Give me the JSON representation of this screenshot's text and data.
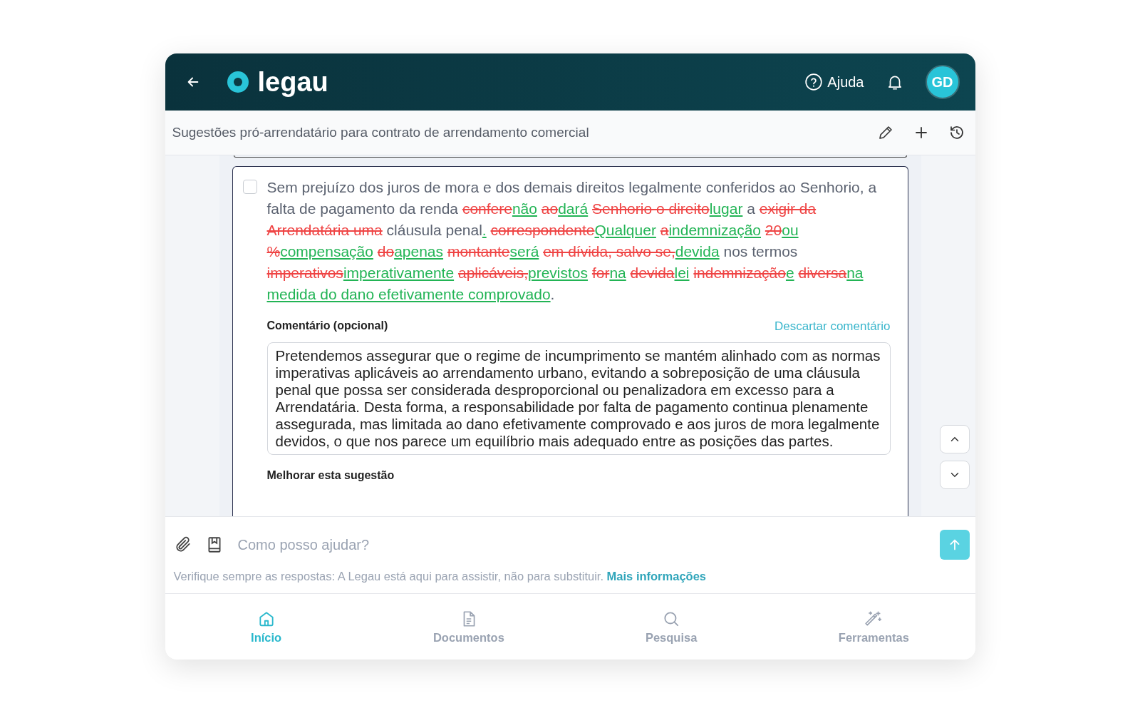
{
  "header": {
    "logo": "legau",
    "help": "Ajuda",
    "avatar": "GD"
  },
  "conversation": {
    "title": "Sugestões pró-arrendatário para contrato de arrendamento comercial"
  },
  "suggestion": {
    "checked": false,
    "segments": [
      {
        "kind": "plain",
        "text": "Sem prejuízo dos juros de mora e dos demais direitos legalmente conferidos ao Senhorio, a falta de pagamento da renda"
      },
      {
        "kind": "del",
        "text": "confere",
        "space_before": true
      },
      {
        "kind": "ins",
        "text": "não"
      },
      {
        "kind": "del",
        "text": "ao",
        "space_before": true
      },
      {
        "kind": "ins",
        "text": "dará"
      },
      {
        "kind": "del",
        "text": "Senhorio o direito",
        "space_before": true
      },
      {
        "kind": "ins",
        "text": "lugar"
      },
      {
        "kind": "plain",
        "text": "a",
        "space_before": true
      },
      {
        "kind": "del",
        "text": "exigir da Arrendatária uma",
        "space_before": true
      },
      {
        "kind": "plain",
        "text": "cláusula penal",
        "space_before": true
      },
      {
        "kind": "ins",
        "text": "."
      },
      {
        "kind": "del",
        "text": "correspondente",
        "space_before": true
      },
      {
        "kind": "ins",
        "text": "Qualquer"
      },
      {
        "kind": "del",
        "text": "a",
        "space_before": true
      },
      {
        "kind": "ins",
        "text": "indemnização"
      },
      {
        "kind": "del",
        "text": "20",
        "space_before": true
      },
      {
        "kind": "ins",
        "text": "ou"
      },
      {
        "kind": "del",
        "text": "%",
        "space_before": true
      },
      {
        "kind": "ins",
        "text": "compensação"
      },
      {
        "kind": "del",
        "text": "do",
        "space_before": true
      },
      {
        "kind": "ins",
        "text": "apenas"
      },
      {
        "kind": "del",
        "text": "montante",
        "space_before": true
      },
      {
        "kind": "ins",
        "text": "será"
      },
      {
        "kind": "del",
        "text": "em dívida, salvo se,",
        "space_before": true
      },
      {
        "kind": "ins",
        "text": "devida"
      },
      {
        "kind": "plain",
        "text": "nos termos",
        "space_before": true
      },
      {
        "kind": "del",
        "text": "imperativos",
        "space_before": true
      },
      {
        "kind": "ins",
        "text": "imperativamente"
      },
      {
        "kind": "del",
        "text": "aplicáveis,",
        "space_before": true
      },
      {
        "kind": "ins",
        "text": "previstos"
      },
      {
        "kind": "del",
        "text": "for",
        "space_before": true
      },
      {
        "kind": "ins",
        "text": "na"
      },
      {
        "kind": "del",
        "text": "devida",
        "space_before": true
      },
      {
        "kind": "ins",
        "text": "lei"
      },
      {
        "kind": "del",
        "text": "indemnização",
        "space_before": true
      },
      {
        "kind": "ins",
        "text": "e"
      },
      {
        "kind": "del",
        "text": "diversa",
        "space_before": true
      },
      {
        "kind": "ins",
        "text": "na medida do dano efetivamente comprovado"
      },
      {
        "kind": "plain",
        "text": "."
      }
    ],
    "comment_label": "Comentário (opcional)",
    "discard_link": "Descartar comentário",
    "comment": "Pretendemos assegurar que o regime de incumprimento se mantém alinhado com as normas imperativas aplicáveis ao arrendamento urbano, evitando a sobreposição de uma cláusula penal que possa ser considerada desproporcional ou penalizadora em excesso para a Arrendatária. Desta forma, a responsabilidade por falta de pagamento continua plenamente assegurada, mas limitada ao dano efetivamente comprovado e aos juros de mora legalmente devidos, o que nos parece um equilíbrio mais adequado entre as posições das partes.",
    "improve_label": "Melhorar esta sugestão"
  },
  "composer": {
    "placeholder": "Como posso ajudar?",
    "disclaimer": "Verifique sempre as respostas: A Legau está aqui para assistir, não para substituir.",
    "more_link": "Mais informações"
  },
  "nav": [
    {
      "label": "Início",
      "selected": true
    },
    {
      "label": "Documentos",
      "selected": false
    },
    {
      "label": "Pesquisa",
      "selected": false
    },
    {
      "label": "Ferramentas",
      "selected": false
    }
  ]
}
